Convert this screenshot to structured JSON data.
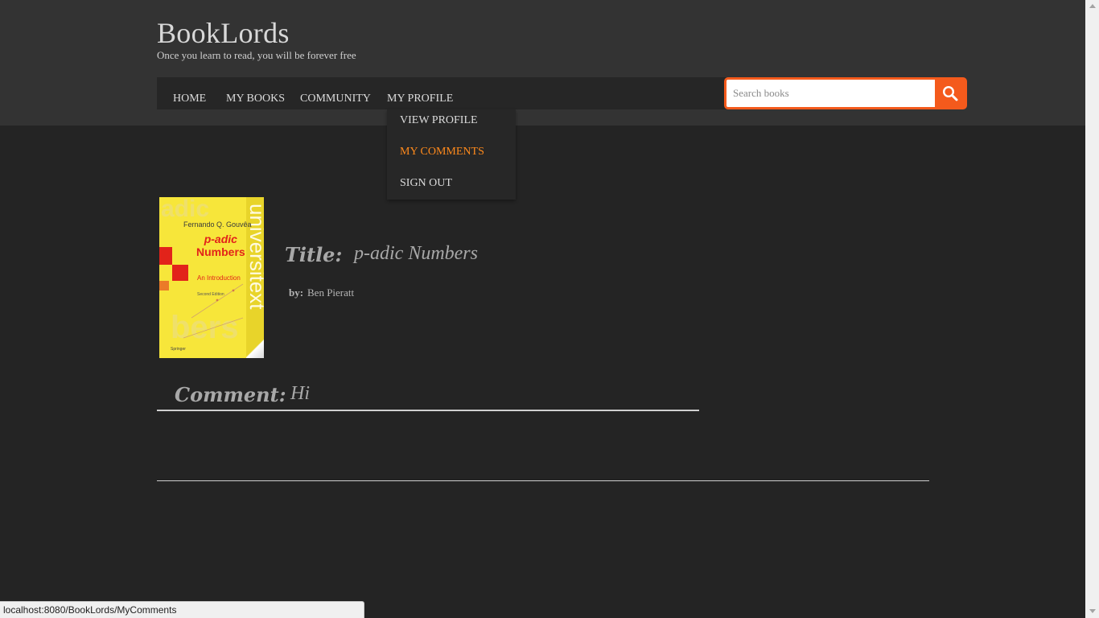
{
  "site": {
    "title": "BookLords",
    "tagline": "Once you learn to read, you will be forever free"
  },
  "nav": {
    "items": [
      {
        "label": "HOME"
      },
      {
        "label": "MY BOOKS"
      },
      {
        "label": "COMMUNITY"
      },
      {
        "label": "MY PROFILE"
      }
    ]
  },
  "profile_menu": {
    "items": [
      {
        "label": "VIEW PROFILE",
        "active": false
      },
      {
        "label": "MY COMMENTS",
        "active": true
      },
      {
        "label": "SIGN OUT",
        "active": false
      }
    ]
  },
  "search": {
    "placeholder": "Search books",
    "value": "",
    "button_icon": "search-icon"
  },
  "book": {
    "title_label": "Title:",
    "title": "p-adic Numbers",
    "by_label": "by:",
    "author": "Ben Pieratt",
    "cover": {
      "author": "Fernando Q. Gouvêa",
      "title_line1": "p-adic",
      "title_line2": "Numbers",
      "subtitle": "An Introduction",
      "edition": "Second Edition",
      "series": "universitext",
      "publisher": "Springer",
      "ghost_text_top": "adic",
      "ghost_text_bottom": "bers"
    }
  },
  "comment": {
    "label": "Comment:",
    "text": "Hi"
  },
  "status_bar": {
    "url": "localhost:8080/BookLords/MyComments"
  },
  "colors": {
    "page_background": "#242424",
    "header_background": "#333333",
    "accent": "#f45a1c",
    "active_menu": "#ff8a1c"
  }
}
